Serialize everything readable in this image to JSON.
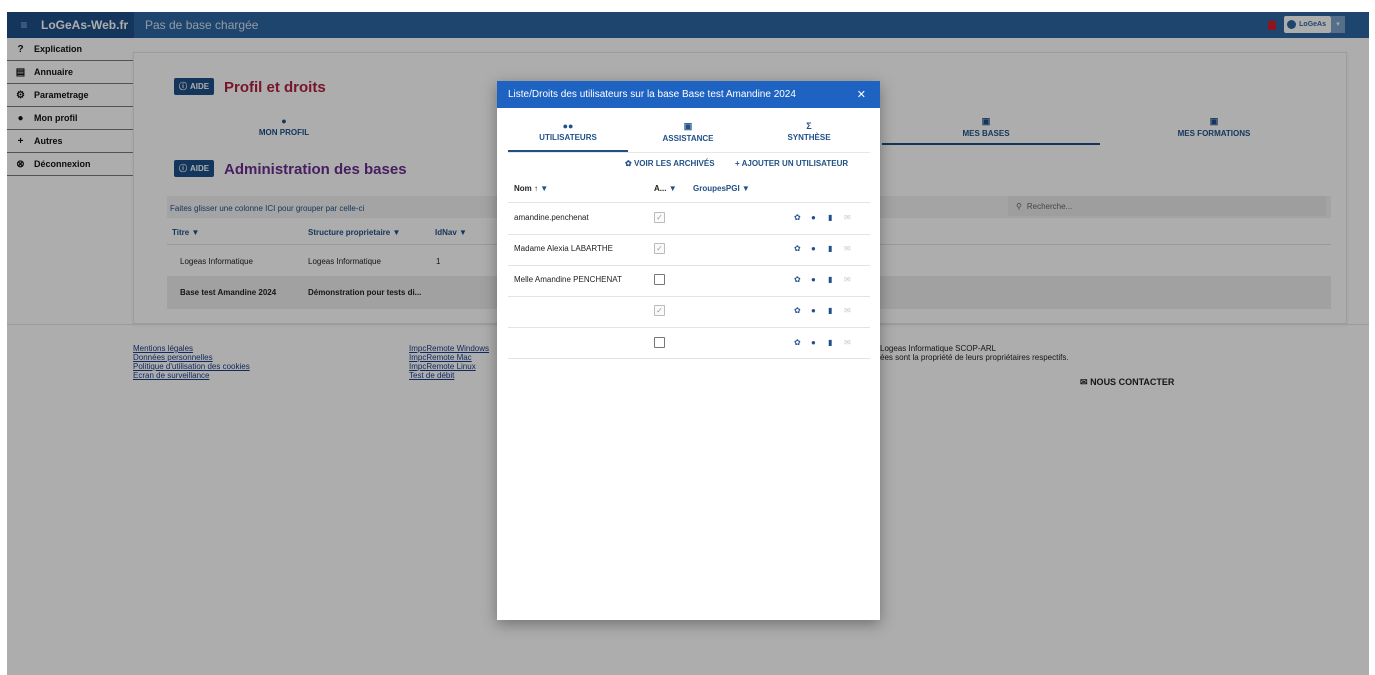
{
  "header": {
    "brand": "LoGeAs-Web.fr",
    "page_heading": "Pas de base chargée",
    "user_label": "LoGeAs",
    "menu_icon": "hamburger-icon",
    "caret": "▾"
  },
  "sidebar": {
    "items": [
      {
        "label": "Explication",
        "icon": "question-circle-icon",
        "glyph": "?"
      },
      {
        "label": "Annuaire",
        "icon": "address-book-icon",
        "glyph": "▤"
      },
      {
        "label": "Parametrage",
        "icon": "gear-icon",
        "glyph": "⚙"
      },
      {
        "label": "Mon profil",
        "icon": "user-icon",
        "glyph": "●"
      },
      {
        "label": "Autres",
        "icon": "plus-icon",
        "glyph": "+"
      },
      {
        "label": "Déconnexion",
        "icon": "close-circle-icon",
        "glyph": "⊗"
      }
    ]
  },
  "profil": {
    "aide": "AIDE",
    "title": "Profil et droits",
    "tabs": [
      {
        "label": "MON PROFIL",
        "icon": "user-icon"
      },
      {
        "label": "MES BASES",
        "icon": "chart-icon"
      },
      {
        "label": "MES FORMATIONS",
        "icon": "calendar-icon"
      }
    ]
  },
  "admin": {
    "aide": "AIDE",
    "title": "Administration des bases",
    "group_hint": "Faites glisser une colonne ICI pour grouper par celle-ci",
    "search_placeholder": "Recherche...",
    "columns": [
      "Titre",
      "Structure proprietaire",
      "IdNav"
    ],
    "rows": [
      {
        "titre": "Logeas Informatique",
        "structure": "Logeas Informatique",
        "idnav": "1"
      },
      {
        "titre": "Base test Amandine 2024",
        "structure": "Démonstration pour tests di...",
        "idnav": ""
      }
    ]
  },
  "footer": {
    "col1": [
      "Mentions légales",
      "Données personnelles",
      "Politique d'utilisation des cookies",
      "Ecran de surveillance"
    ],
    "col2": [
      "ImpcRemote Windows",
      "ImpcRemote Mac",
      "ImpcRemote Linux",
      "Test de débit"
    ],
    "company": "Logeas Informatique SCOP-ARL",
    "rights": "ées sont la propriété de leurs propriétaires respectifs.",
    "contact": "NOUS CONTACTER"
  },
  "modal": {
    "title": "Liste/Droits des utilisateurs sur la base Base test Amandine 2024",
    "close": "✕",
    "tabs": [
      {
        "label": "UTILISATEURS",
        "icon": "users-icon",
        "glyph": "👥",
        "active": true
      },
      {
        "label": "ASSISTANCE",
        "icon": "chart-icon",
        "glyph": "▣",
        "active": false
      },
      {
        "label": "SYNTHÈSE",
        "icon": "sigma-icon",
        "glyph": "Σ",
        "active": false
      }
    ],
    "actions": {
      "archives": "VOIR LES ARCHIVÉS",
      "add_user": "AJOUTER UN UTILISATEUR"
    },
    "columns": {
      "nom": "Nom",
      "a": "A...",
      "groupes": "GroupesPGI"
    },
    "users": [
      {
        "name": "amandine.penchenat",
        "checked": true,
        "disabled": true
      },
      {
        "name": "Madame Alexia LABARTHE",
        "checked": true,
        "disabled": true
      },
      {
        "name": "Melle Amandine PENCHENAT",
        "checked": false,
        "disabled": false
      },
      {
        "name": "",
        "checked": true,
        "disabled": true
      },
      {
        "name": "",
        "checked": false,
        "disabled": false
      }
    ]
  }
}
